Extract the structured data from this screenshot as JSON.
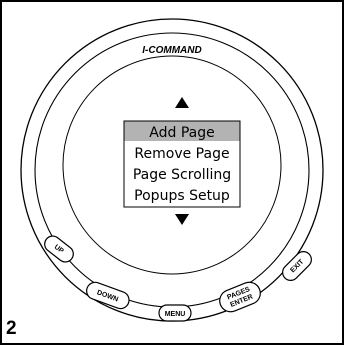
{
  "device": {
    "brand": "I-COMMAND"
  },
  "menu": {
    "items": [
      {
        "label": "Add Page",
        "selected": true
      },
      {
        "label": "Remove Page",
        "selected": false
      },
      {
        "label": "Page Scrolling",
        "selected": false
      },
      {
        "label": "Popups Setup",
        "selected": false
      }
    ],
    "scroll_up_icon": "triangle-up-icon",
    "scroll_down_icon": "triangle-down-icon"
  },
  "buttons": {
    "up": "UP",
    "down": "DOWN",
    "menu": "MENU",
    "pages_enter_line1": "PAGES",
    "pages_enter_line2": "ENTER",
    "exit": "EXIT"
  },
  "figure": {
    "number": "2"
  },
  "colors": {
    "selected_bg": "#b3b3b3",
    "outline": "#000000"
  }
}
